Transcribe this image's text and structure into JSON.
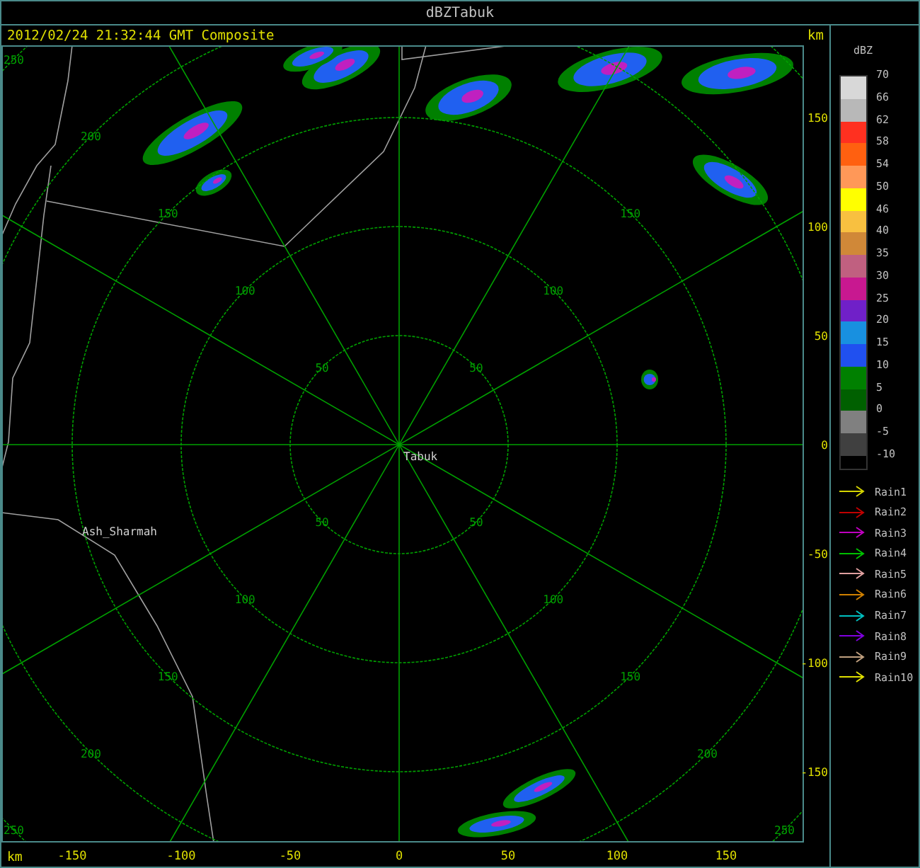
{
  "window": {
    "title": "dBZTabuk"
  },
  "header": {
    "timestamp": "2012/02/24 21:32:44 GMT Composite",
    "unit": "km"
  },
  "plot": {
    "x_axis": {
      "unit": "km",
      "labels": [
        "-150",
        "-100",
        "-50",
        "0",
        "50",
        "100",
        "150"
      ]
    },
    "y_axis": {
      "labels": [
        "150",
        "100",
        "50",
        "0",
        "-50",
        "-100",
        "-150"
      ]
    },
    "range_rings": [
      {
        "nw": "50",
        "ne": "50",
        "sw": "50",
        "se": "50"
      },
      {
        "nw": "100",
        "ne": "100",
        "sw": "100",
        "se": "100"
      },
      {
        "nw": "150",
        "ne": "150",
        "sw": "150",
        "se": "150"
      },
      {
        "nw": "200",
        "sw": "200",
        "se": "200"
      },
      {
        "nw": "250",
        "sw": "250",
        "se": "250"
      }
    ],
    "places": [
      {
        "name": "Tabuk"
      },
      {
        "name": "Ash_Sharmah"
      }
    ]
  },
  "legend": {
    "unit": "dBZ",
    "scale_labels": [
      "70",
      "66",
      "62",
      "58",
      "54",
      "50",
      "46",
      "40",
      "35",
      "30",
      "25",
      "20",
      "15",
      "10",
      "5",
      "0",
      "-5",
      "-10"
    ],
    "bands": [
      {
        "color": "#d8d8d8"
      },
      {
        "color": "#b8b8b8"
      },
      {
        "color": "#ff3020"
      },
      {
        "color": "#ff6010"
      },
      {
        "color": "#ff9858"
      },
      {
        "color": "#ffff00"
      },
      {
        "color": "#f8c040"
      },
      {
        "color": "#d08838"
      },
      {
        "color": "#c06080"
      },
      {
        "color": "#c81890"
      },
      {
        "color": "#7020c8"
      },
      {
        "color": "#1890e0"
      },
      {
        "color": "#2050f0"
      },
      {
        "color": "#008000"
      },
      {
        "color": "#006000"
      },
      {
        "color": "#808080"
      },
      {
        "color": "#404040"
      }
    ],
    "tracks": [
      {
        "label": "Rain1",
        "color": "#d4d400"
      },
      {
        "label": "Rain2",
        "color": "#c00000"
      },
      {
        "label": "Rain3",
        "color": "#c000c0"
      },
      {
        "label": "Rain4",
        "color": "#00c000"
      },
      {
        "label": "Rain5",
        "color": "#e0a0a0"
      },
      {
        "label": "Rain6",
        "color": "#d08000"
      },
      {
        "label": "Rain7",
        "color": "#00c0c0"
      },
      {
        "label": "Rain8",
        "color": "#8000e0"
      },
      {
        "label": "Rain9",
        "color": "#c0a080"
      },
      {
        "label": "Rain10",
        "color": "#e0e000"
      }
    ]
  }
}
